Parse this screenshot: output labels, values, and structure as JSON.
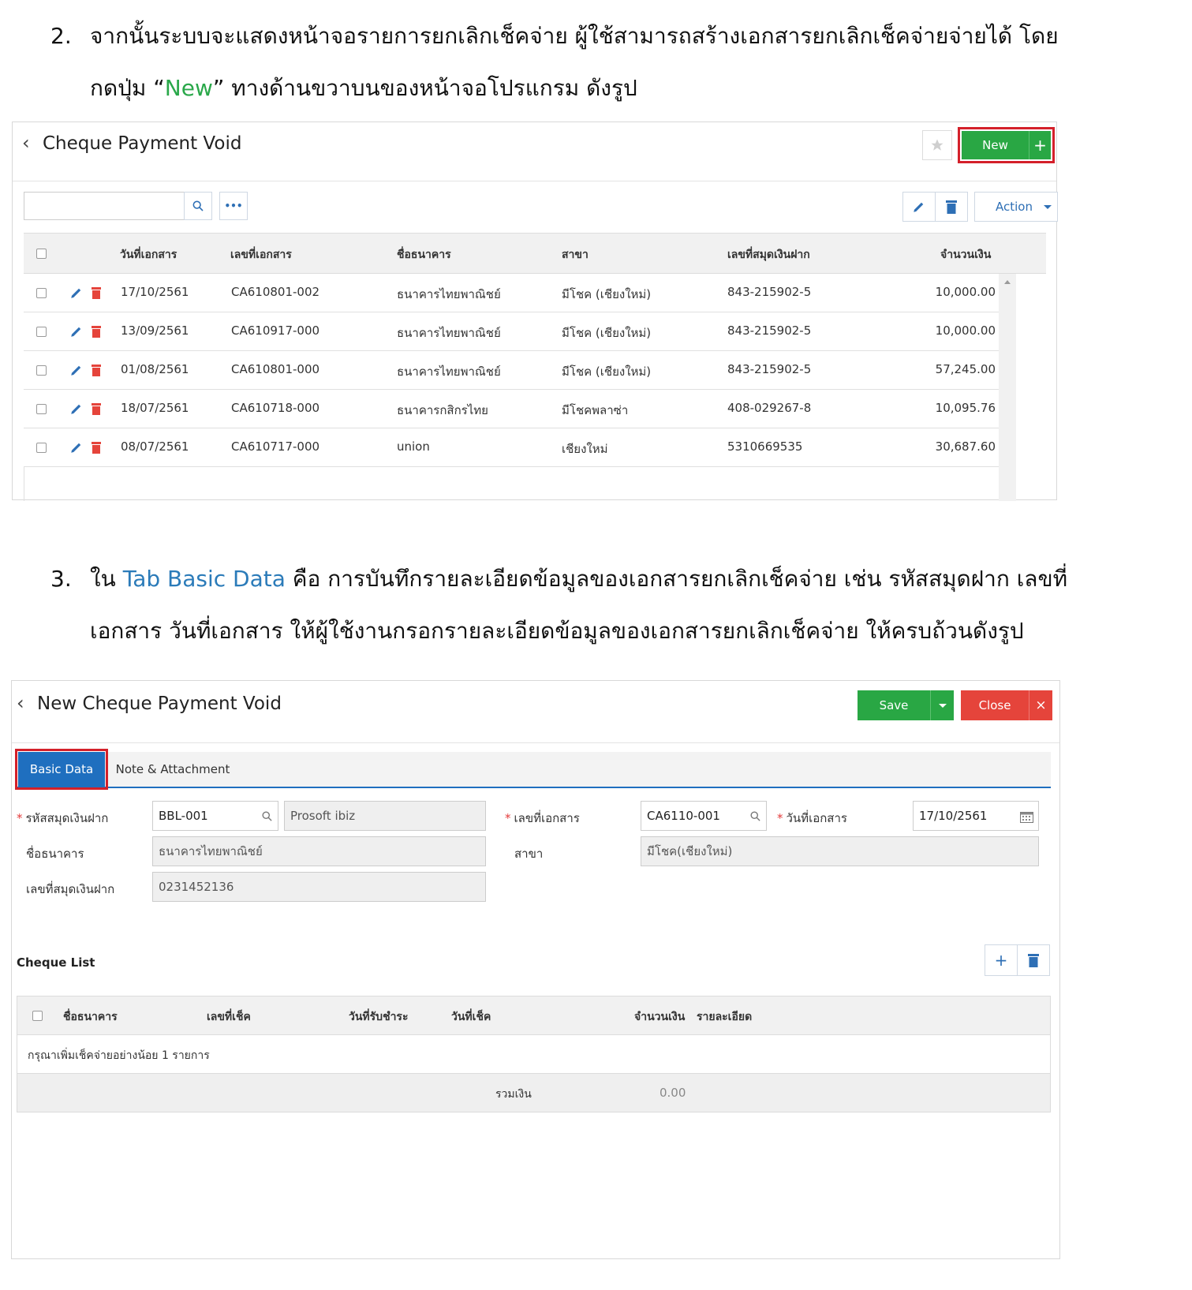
{
  "step2": {
    "number": "2.",
    "line1": "จากนั้นระบบจะแสดงหน้าจอรายการยกเลิกเช็คจ่าย ผู้ใช้สามารถสร้างเอกสารยกเลิกเช็คจ่ายจ่ายได้ โดย",
    "line2_pre": "กดปุ่ม “",
    "line2_hl": "New",
    "line2_post": "” ทางด้านขวาบนของหน้าจอโปรแกรม ดังรูป"
  },
  "list_screen": {
    "title": "Cheque Payment Void",
    "new_label": "New",
    "new_plus": "+",
    "action_label": "Action",
    "search_placeholder": "",
    "more_label": "•••",
    "columns": [
      "วันที่เอกสาร",
      "เลขที่เอกสาร",
      "ชื่อธนาคาร",
      "สาขา",
      "เลขที่สมุดเงินฝาก",
      "จำนวนเงิน"
    ],
    "rows": [
      {
        "date": "17/10/2561",
        "doc": "CA610801-002",
        "bank": "ธนาคารไทยพาณิชย์",
        "branch": "มีโชค (เชียงใหม่)",
        "account": "843-215902-5",
        "amount": "10,000.00"
      },
      {
        "date": "13/09/2561",
        "doc": "CA610917-000",
        "bank": "ธนาคารไทยพาณิชย์",
        "branch": "มีโชค (เชียงใหม่)",
        "account": "843-215902-5",
        "amount": "10,000.00"
      },
      {
        "date": "01/08/2561",
        "doc": "CA610801-000",
        "bank": "ธนาคารไทยพาณิชย์",
        "branch": "มีโชค (เชียงใหม่)",
        "account": "843-215902-5",
        "amount": "57,245.00"
      },
      {
        "date": "18/07/2561",
        "doc": "CA610718-000",
        "bank": "ธนาคารกสิกรไทย",
        "branch": "มีโชคพลาซ่า",
        "account": "408-029267-8",
        "amount": "10,095.76"
      },
      {
        "date": "08/07/2561",
        "doc": "CA610717-000",
        "bank": "union",
        "branch": "เชียงใหม่",
        "account": "5310669535",
        "amount": "30,687.60"
      }
    ]
  },
  "step3": {
    "number": "3.",
    "line1_pre": "ใน ",
    "line1_hl": "Tab Basic Data",
    "line1_post": " คือ การบันทึกรายละเอียดข้อมูลของเอกสารยกเลิกเช็คจ่าย เช่น รหัสสมุดฝาก เลขที่",
    "line2": "เอกสาร วันที่เอกสาร ให้ผู้ใช้งานกรอกรายละเอียดข้อมูลของเอกสารยกเลิกเช็คจ่าย ให้ครบถ้วนดังรูป"
  },
  "form_screen": {
    "title": "New Cheque Payment Void",
    "save_label": "Save",
    "close_label": "Close",
    "close_x": "×",
    "tabs": [
      "Basic Data",
      "Note & Attachment"
    ],
    "fields": {
      "account_code_label": "รหัสสมุดเงินฝาก",
      "account_code_value": "BBL-001",
      "account_name_value": "Prosoft ibiz",
      "doc_no_label": "เลขที่เอกสาร",
      "doc_no_value": "CA6110-001",
      "doc_date_label": "วันที่เอกสาร",
      "doc_date_value": "17/10/2561",
      "bank_label": "ชื่อธนาคาร",
      "bank_value": "ธนาคารไทยพาณิชย์",
      "branch_label": "สาขา",
      "branch_value": "มีโชค(เชียงใหม่)",
      "account_no_label": "เลขที่สมุดเงินฝาก",
      "account_no_value": "0231452136"
    },
    "cheque_list": {
      "title": "Cheque List",
      "add_label": "+",
      "columns": [
        "ชื่อธนาคาร",
        "เลขที่เช็ค",
        "วันที่รับชำระ",
        "วันที่เช็ค",
        "จำนวนเงิน",
        "รายละเอียด"
      ],
      "empty_message": "กรุณาเพิ่มเช็คจ่ายอย่างน้อย 1 รายการ",
      "total_label": "รวมเงิน",
      "total_value": "0.00"
    }
  },
  "colors": {
    "green": "#29a744",
    "red": "#e5443b",
    "blue": "#1f6fbf",
    "highlight": "#d4202a"
  }
}
